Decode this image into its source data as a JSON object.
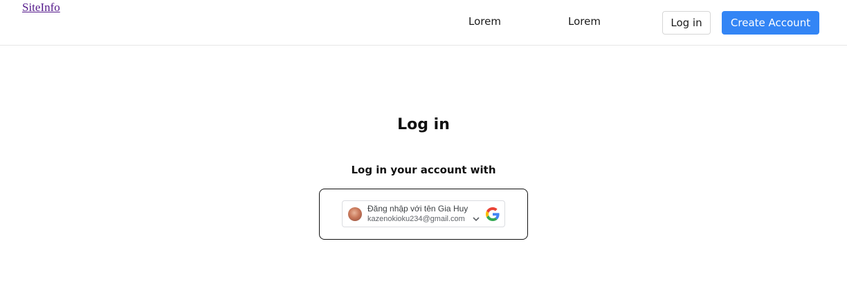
{
  "header": {
    "site_link": "SiteInfo",
    "nav": [
      "Lorem",
      "Lorem"
    ],
    "login_label": "Log in",
    "create_label": "Create Account"
  },
  "main": {
    "title": "Log in",
    "subtitle": "Log in your account with"
  },
  "google_signin": {
    "name_line": "Đăng nhập với tên Gia Huy",
    "email": "kazenokioku234@gmail.com",
    "icon": "google-icon"
  },
  "colors": {
    "accent": "#3385f5",
    "link": "#551a8b",
    "border": "#111111"
  }
}
